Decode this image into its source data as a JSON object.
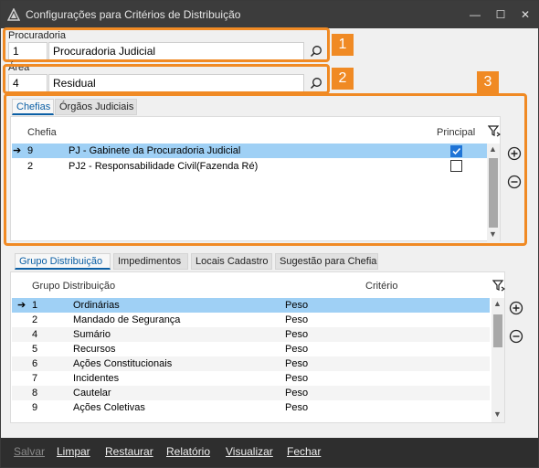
{
  "window": {
    "title": "Configurações para Critérios de Distribuição",
    "minimize": "—",
    "maximize": "☐",
    "close": "✕"
  },
  "procuradoria": {
    "label": "Procuradoria",
    "code": "1",
    "name": "Procuradoria Judicial"
  },
  "area": {
    "label": "Área",
    "code": "4",
    "name": "Residual"
  },
  "badges": [
    "1",
    "2",
    "3"
  ],
  "chefias_tabs": [
    "Chefias",
    "Órgãos Judiciais"
  ],
  "chefias_grid": {
    "headers": {
      "chefia": "Chefia",
      "principal": "Principal"
    },
    "rows": [
      {
        "code": "9",
        "name": "PJ - Gabinete da Procuradoria Judicial",
        "principal": true,
        "selected": true
      },
      {
        "code": "2",
        "name": "PJ2 - Responsabilidade Civil(Fazenda Ré)",
        "principal": false,
        "selected": false
      }
    ]
  },
  "grupo_tabs": [
    "Grupo Distribuição",
    "Impedimentos",
    "Locais Cadastro",
    "Sugestão para Chefia"
  ],
  "grupo_grid": {
    "headers": {
      "grupo": "Grupo Distribuição",
      "criterio": "Critério"
    },
    "rows": [
      {
        "code": "1",
        "name": "Ordinárias",
        "criterio": "Peso"
      },
      {
        "code": "2",
        "name": "Mandado de Segurança",
        "criterio": "Peso"
      },
      {
        "code": "4",
        "name": "Sumário",
        "criterio": "Peso"
      },
      {
        "code": "5",
        "name": "Recursos",
        "criterio": "Peso"
      },
      {
        "code": "6",
        "name": "Ações Constitucionais",
        "criterio": "Peso"
      },
      {
        "code": "7",
        "name": "Incidentes",
        "criterio": "Peso"
      },
      {
        "code": "8",
        "name": "Cautelar",
        "criterio": "Peso"
      },
      {
        "code": "9",
        "name": "Ações Coletivas",
        "criterio": "Peso"
      }
    ]
  },
  "toolbar": {
    "salvar": "Salvar",
    "limpar": "Limpar",
    "restaurar": "Restaurar",
    "relatorio": "Relatório",
    "visualizar": "Visualizar",
    "fechar": "Fechar"
  },
  "colors": {
    "highlight": "#f08a24",
    "selection": "#9fd0f5",
    "accent": "#0b5fa5"
  }
}
